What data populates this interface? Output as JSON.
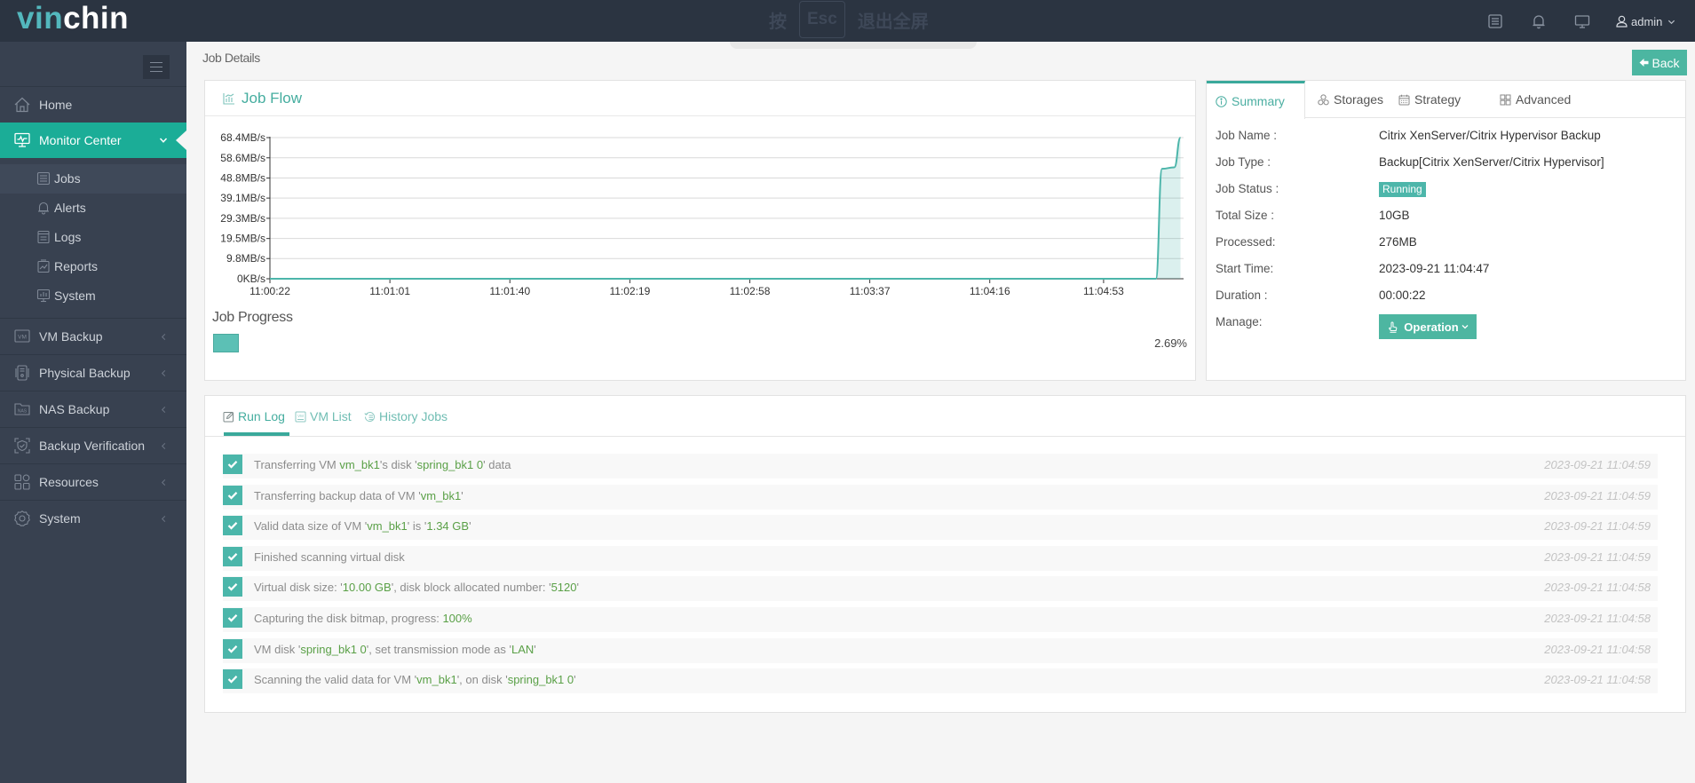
{
  "app": {
    "logo_part1": "vin",
    "logo_part2": "chin",
    "fullscreen_hint": {
      "press": "按",
      "key": "Esc",
      "action": "退出全屏"
    }
  },
  "header": {
    "icons": [
      "list-icon",
      "bell-icon",
      "monitor-icon"
    ],
    "user": "admin"
  },
  "sidebar": {
    "items": [
      {
        "label": "Home",
        "icon": "home-icon"
      },
      {
        "label": "Monitor Center",
        "icon": "monitor-pulse-icon",
        "active": true,
        "expanded": true
      },
      {
        "label": "VM Backup",
        "icon": "vm-icon"
      },
      {
        "label": "Physical Backup",
        "icon": "physical-server-icon"
      },
      {
        "label": "NAS Backup",
        "icon": "nas-folder-icon"
      },
      {
        "label": "Backup Verification",
        "icon": "shield-check-icon"
      },
      {
        "label": "Resources",
        "icon": "resources-grid-icon"
      },
      {
        "label": "System",
        "icon": "gear-icon"
      }
    ],
    "submenu": [
      {
        "label": "Jobs",
        "icon": "list-icon",
        "active": true
      },
      {
        "label": "Alerts",
        "icon": "bell-icon"
      },
      {
        "label": "Logs",
        "icon": "document-icon"
      },
      {
        "label": "Reports",
        "icon": "report-icon"
      },
      {
        "label": "System",
        "icon": "system-monitor-icon"
      }
    ]
  },
  "page": {
    "title": "Job Details",
    "back_label": "Back"
  },
  "job_flow": {
    "title": "Job Flow",
    "progress_label": "Job Progress",
    "progress_percent": 2.69,
    "progress_text": "2.69%"
  },
  "chart_data": {
    "type": "area",
    "title": "Job Flow",
    "xlabel": "",
    "ylabel": "",
    "y_unit": "MB/s",
    "x_ticks": [
      "11:00:22",
      "11:01:01",
      "11:01:40",
      "11:02:19",
      "11:02:58",
      "11:03:37",
      "11:04:16",
      "11:04:53"
    ],
    "y_ticks": [
      {
        "value": 0,
        "label": "0KB/s"
      },
      {
        "value": 9.8,
        "label": "9.8MB/s"
      },
      {
        "value": 19.5,
        "label": "19.5MB/s"
      },
      {
        "value": 29.3,
        "label": "29.3MB/s"
      },
      {
        "value": 39.1,
        "label": "39.1MB/s"
      },
      {
        "value": 48.8,
        "label": "48.8MB/s"
      },
      {
        "value": 58.6,
        "label": "58.6MB/s"
      },
      {
        "value": 68.4,
        "label": "68.4MB/s"
      }
    ],
    "xlim": [
      "11:00:22",
      "11:05:19"
    ],
    "ylim": [
      0,
      68.4
    ],
    "grid": true,
    "legend": "none",
    "series": [
      {
        "x": [
          "11:00:22",
          "11:05:10",
          "11:05:12",
          "11:05:16",
          "11:05:18"
        ],
        "values": [
          0,
          0,
          53.3,
          54.0,
          68.4
        ]
      }
    ]
  },
  "summary": {
    "tabs": [
      {
        "label": "Summary",
        "icon": "info-icon",
        "active": true
      },
      {
        "label": "Storages",
        "icon": "storages-icon"
      },
      {
        "label": "Strategy",
        "icon": "calendar-icon"
      },
      {
        "label": "Advanced",
        "icon": "grid-icon"
      }
    ],
    "rows": [
      {
        "label": "Job Name :",
        "value": "Citrix XenServer/Citrix Hypervisor Backup"
      },
      {
        "label": "Job Type :",
        "value": "Backup[Citrix XenServer/Citrix Hypervisor]"
      },
      {
        "label": "Job Status :",
        "value": "Running"
      },
      {
        "label": "Total Size :",
        "value": "10GB"
      },
      {
        "label": "Processed:",
        "value": "276MB"
      },
      {
        "label": "Start Time:",
        "value": "2023-09-21 11:04:47"
      },
      {
        "label": "Duration :",
        "value": "00:00:22"
      },
      {
        "label": "Manage:",
        "value": "Operation"
      }
    ]
  },
  "run_log": {
    "tabs": [
      {
        "label": "Run Log",
        "icon": "edit-icon",
        "active": true
      },
      {
        "label": "VM List",
        "icon": "vm-list-icon"
      },
      {
        "label": "History Jobs",
        "icon": "history-icon"
      }
    ],
    "entries": [
      {
        "segments": [
          {
            "text": "Transferring VM "
          },
          {
            "text": "vm_bk1",
            "hl": true
          },
          {
            "text": "'s disk '"
          },
          {
            "text": "spring_bk1 0",
            "hl": true
          },
          {
            "text": "' data"
          }
        ],
        "time": "2023-09-21 11:04:59"
      },
      {
        "segments": [
          {
            "text": "Transferring backup data of VM '"
          },
          {
            "text": "vm_bk1",
            "hl": true
          },
          {
            "text": "'"
          }
        ],
        "time": "2023-09-21 11:04:59"
      },
      {
        "segments": [
          {
            "text": "Valid data size of VM '"
          },
          {
            "text": "vm_bk1",
            "hl": true
          },
          {
            "text": "' is '"
          },
          {
            "text": "1.34 GB",
            "hl": true
          },
          {
            "text": "'"
          }
        ],
        "time": "2023-09-21 11:04:59"
      },
      {
        "segments": [
          {
            "text": "Finished scanning virtual disk"
          }
        ],
        "time": "2023-09-21 11:04:59"
      },
      {
        "segments": [
          {
            "text": "Virtual disk size: '"
          },
          {
            "text": "10.00 GB",
            "hl": true
          },
          {
            "text": "', disk block allocated number: '"
          },
          {
            "text": "5120",
            "hl": true
          },
          {
            "text": "'"
          }
        ],
        "time": "2023-09-21 11:04:58"
      },
      {
        "segments": [
          {
            "text": "Capturing the disk bitmap, progress: "
          },
          {
            "text": "100%",
            "hl": true
          }
        ],
        "time": "2023-09-21 11:04:58"
      },
      {
        "segments": [
          {
            "text": "VM disk '"
          },
          {
            "text": "spring_bk1 0",
            "hl": true
          },
          {
            "text": "', set transmission mode as '"
          },
          {
            "text": "LAN",
            "hl": true
          },
          {
            "text": "'"
          }
        ],
        "time": "2023-09-21 11:04:58"
      },
      {
        "segments": [
          {
            "text": "Scanning the valid data for VM '"
          },
          {
            "text": "vm_bk1",
            "hl": true
          },
          {
            "text": "', on disk '"
          },
          {
            "text": "spring_bk1 0",
            "hl": true
          },
          {
            "text": "'"
          }
        ],
        "time": "2023-09-21 11:04:58"
      }
    ]
  },
  "colors": {
    "accent": "#1bad97",
    "topbar": "#2b3441",
    "sidebar": "#384150",
    "highlight_text": "#5aa047",
    "chart_line": "#4cb5aa"
  }
}
